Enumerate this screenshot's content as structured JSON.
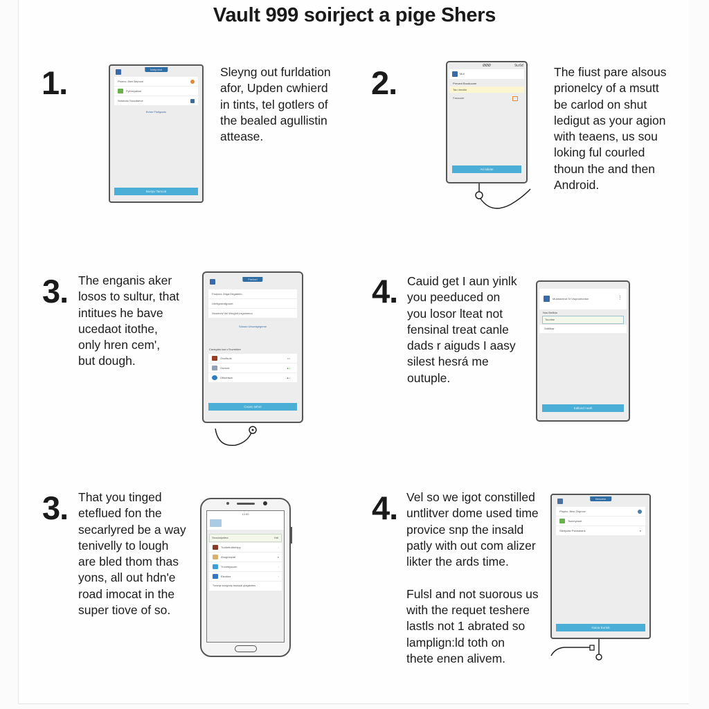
{
  "title": "Vault 999 soirject a pige Shers",
  "steps": [
    {
      "number": "1.",
      "text": "Sleyng out furldation\nafor, Upden cwhierd\nin tints, tel gotlers of\nthe bealed agullistin\nattease.",
      "screen": {
        "tab_label": "Nobpobut",
        "rows": [
          "Ptoenc Jhen Bepove",
          "Pyimnyatbal",
          "Setobotv Ssovdaeve"
        ],
        "link": "Bvtne Plutigaato",
        "button": "Bostyv Tamcat"
      }
    },
    {
      "number": "2.",
      "text": "The fiust pare alsous\nprionelcy of a msutt\nbe carlod on shut\nledigut as your agion\nwith teaens, us sou\nloking ful courled\nthoun the and then\nAndroid.",
      "screen": {
        "status_center": "ØØØ",
        "status_right": "9u:6ď",
        "app_name": "Muf",
        "section_label": "Prnvant Bouducare",
        "highlighted_field": "Tau drealta",
        "row": "Facsoute",
        "button": "Ari takate"
      }
    },
    {
      "number": "3.",
      "text": "The enganis aker\nlosos to sultur, that\nintitues he bave\nucedaot itothe,\nonly hren cem',\nbut dough.",
      "screen": {
        "tab_label": "Frerlcel",
        "rows": [
          "Frsipors Jhiga Degabeto",
          "Uhrfigmeoltjpoort",
          "Seuntrciv'Vel Wrughlt Legsbeeno"
        ],
        "link": "Sdusto Utrumtgegeme",
        "section_label": "Caxegrbs tazr cTuvretidre",
        "apps": [
          {
            "label": "Ovuftsuls",
            "icon": "app-icon",
            "color": "#9b3b24"
          },
          {
            "label": "Ourscic",
            "icon": "app-icon",
            "color": "#8f9fb8"
          },
          {
            "label": "Oftschtwa",
            "icon": "app-icon",
            "color": "#2f7cc4"
          }
        ],
        "button": "Cnoec sehre"
      }
    },
    {
      "number": "4.",
      "text": "Cauid get I aun yinlk\nyou peeduced on\nyou losor lteat not\nfensinal treat canle\ndads r aiguds I aasy\nsilest hesrá me\noutuple.",
      "screen": {
        "app_name": "Muastontrut St Vtuproefonton",
        "section_label": "Nos Brrlllda",
        "highlighted_field": "Tounlbe",
        "row": "Srtitllbar",
        "button": "Ealtund Aeah"
      }
    },
    {
      "number": "3.",
      "text": "That you tinged\neteflued fon the\nsecarlyred be a way\ntenivelly to lough\nare bled thom thas\nyons, all out hdn'e\nroad imocat in the\nsuper tiove of so.",
      "screen": {
        "status_center": "12:00",
        "search_value": "Seuulatpritea",
        "search_badge": "Hdl",
        "apps": [
          {
            "label": "Tuddntrulbehtpy",
            "color": "#8a3a26"
          },
          {
            "label": "Ahugnioplat",
            "color": "#d8b070"
          },
          {
            "label": "Trovetrjaoum",
            "color": "#3ba0d8"
          },
          {
            "label": "Eleotine",
            "color": "#3577c4"
          }
        ],
        "footnote": "Turseqe souignutp baunaoll qsugsbetes"
      }
    },
    {
      "number": "4.",
      "text": "Vel so we igot constilled\nuntlitver dome used time\nprovice snp the insald\npatly with out com alizer\nlikter the ards time.\n\nFulsl and not suorous us\nwith the requet teshere\nlastls not 1 abrated so\nlamplign:ld toth on\nthete enen alivem.",
      "screen": {
        "tab_label": "Nescesn",
        "rows": [
          "Ptopbc Jleor Zegnow",
          "Tsuimyeant",
          "Sterljoatv Pstosteans"
        ],
        "button": "Gaioa Eurtuk"
      }
    }
  ]
}
